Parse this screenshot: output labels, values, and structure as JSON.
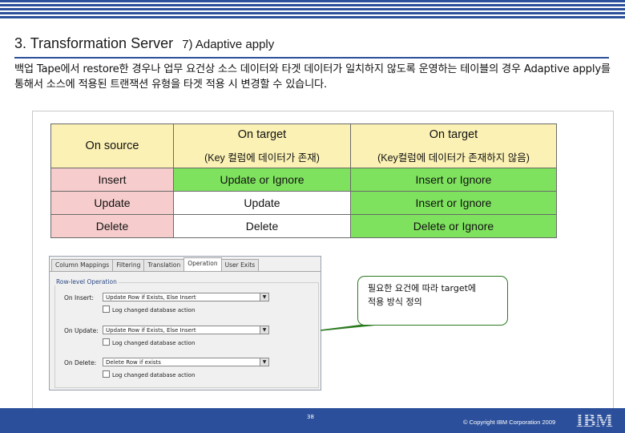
{
  "slide": {
    "title_main": "3. Transformation Server",
    "title_sub": "7) Adaptive apply",
    "description": "백업 Tape에서 restore한 경우나 업무 요건상 소스 데이터와 타겟 데이터가 일치하지 않도록 운영하는 테이블의 경우 Adaptive apply를 통해서 소스에 적용된 트랜잭션 유형을 타겟 적용 시 변경할 수 있습니다."
  },
  "table": {
    "header": {
      "source": "On source",
      "target1_main": "On target",
      "target1_sub": "(Key 컬럼에 데이터가 존재)",
      "target2_main": "On target",
      "target2_sub": "(Key컬럼에 데이터가 존재하지 않음)"
    },
    "rows": [
      {
        "source": "Insert",
        "target1": "Update or Ignore",
        "target2": "Insert or Ignore"
      },
      {
        "source": "Update",
        "target1": "Update",
        "target2": "Insert or Ignore"
      },
      {
        "source": "Delete",
        "target1": "Delete",
        "target2": "Delete or Ignore"
      }
    ]
  },
  "screenshot": {
    "tabs": [
      "Column Mappings",
      "Filtering",
      "Translation",
      "Operation",
      "User Exits"
    ],
    "active_tab": "Operation",
    "group_label": "Row-level Operation",
    "on_insert_label": "On Insert:",
    "on_insert_value": "Update Row if Exists, Else Insert",
    "on_insert_check": "Log changed database action",
    "on_update_label": "On Update:",
    "on_update_value": "Update Row if Exists, Else Insert",
    "on_update_check": "Log changed database action",
    "on_delete_label": "On Delete:",
    "on_delete_value": "Delete Row if exists",
    "on_delete_check": "Log changed database action"
  },
  "callout": {
    "line1": "필요한 요건에 따라 target에",
    "line2": "적용 방식 정의"
  },
  "footer": {
    "page": "38",
    "copyright": "© Copyright IBM Corporation 2009",
    "logo": "IBM"
  },
  "colors": {
    "brand_blue": "#2b4f9a",
    "header_yellow": "#fbf1b4",
    "source_pink": "#f6cccc",
    "target_green": "#7ee25e",
    "callout_border": "#2a7a1e"
  }
}
